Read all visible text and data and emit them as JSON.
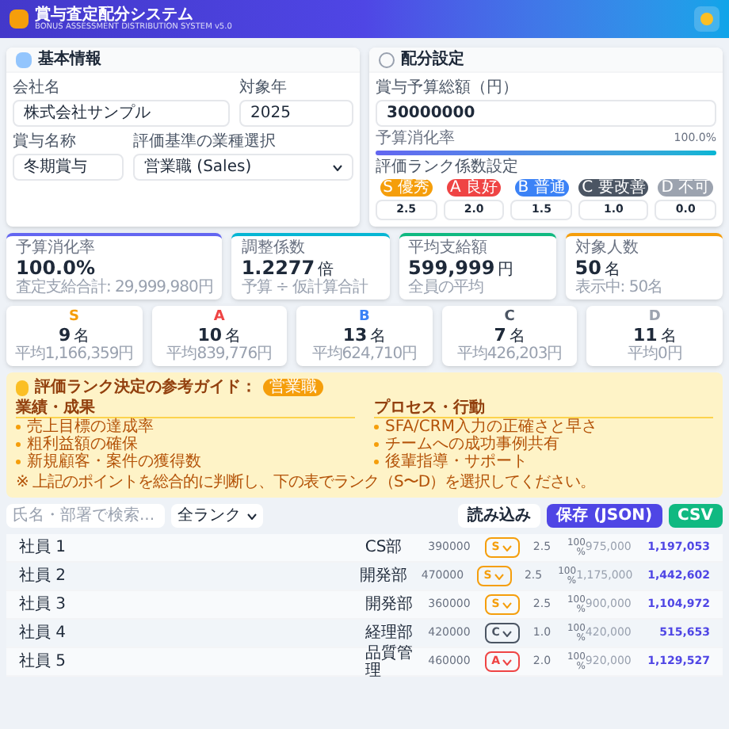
{
  "header": {
    "title": "賞与査定配分システム",
    "subtitle": "BONUS ASSESSMENT DISTRIBUTION SYSTEM v5.0"
  },
  "basic": {
    "title": "基本情報",
    "fields": [
      {
        "label": "会社名",
        "value": "株式会社サンプル"
      },
      {
        "label": "対象年",
        "value": "2025"
      },
      {
        "label": "賞与名称",
        "value": "冬期賞与"
      }
    ],
    "select": {
      "label": "評価基準の業種選択",
      "value": "営業職 (Sales)"
    }
  },
  "distribution": {
    "title": "配分設定",
    "budget_label": "賞与予算総額（円）",
    "budget": "30000000",
    "progress_label": "予算消化率",
    "progress_value": "100.0%",
    "level": 1.0,
    "coef_label": "評価ランク係数設定",
    "ranks": [
      {
        "label": "S 優秀",
        "value": "2.5",
        "color": "#f59e0b"
      },
      {
        "label": "A 良好",
        "value": "2.0",
        "color": "#ef4444"
      },
      {
        "label": "B 普通",
        "value": "1.5",
        "color": "#3b82f6"
      },
      {
        "label": "C 要改善",
        "value": "1.0",
        "color": "#4b5563"
      },
      {
        "label": "D 不可",
        "value": "0.0",
        "color": "#9ca3af"
      }
    ]
  },
  "stats": [
    {
      "label": "予算消化率",
      "value": "100.0%",
      "note": "査定支給合計: 29,999,980円",
      "color": "#6366f1"
    },
    {
      "label": "調整係数",
      "value": "1.2277",
      "unit": "倍",
      "note": "予算 ÷ 仮計算合計",
      "color": "#06b6d4"
    },
    {
      "label": "平均支給額",
      "value": "599,999",
      "unit": "円",
      "note": "全員の平均",
      "color": "#10b981"
    },
    {
      "label": "対象人数",
      "value": "50",
      "unit": "名",
      "note": "表示中: 50名",
      "color": "#f59e0b"
    }
  ],
  "rank_summary": [
    {
      "rank": "S",
      "count": "9",
      "unit": "名",
      "note": "平均1,166,359円",
      "color": "#f59e0b"
    },
    {
      "rank": "A",
      "count": "10",
      "unit": "名",
      "note": "平均839,776円",
      "color": "#ef4444"
    },
    {
      "rank": "B",
      "count": "13",
      "unit": "名",
      "note": "平均624,710円",
      "color": "#3b82f6"
    },
    {
      "rank": "C",
      "count": "7",
      "unit": "名",
      "note": "平均426,203円",
      "color": "#4b5563"
    },
    {
      "rank": "D",
      "count": "11",
      "unit": "名",
      "note": "平均0円",
      "color": "#9ca3af"
    }
  ],
  "guide": {
    "title": "評価ランク決定の参考ガイド：",
    "badge": "営業職",
    "columns": [
      {
        "heading": "業績・成果",
        "items": [
          "売上目標の達成率",
          "粗利益額の確保",
          "新規顧客・案件の獲得数"
        ]
      },
      {
        "heading": "プロセス・行動",
        "items": [
          "SFA/CRM入力の正確さと早さ",
          "チームへの成功事例共有",
          "後輩指導・サポート"
        ]
      }
    ],
    "note": "※ 上記のポイントを総合的に判断し、下の表でランク（S〜D）を選択してください。"
  },
  "toolbar": {
    "search_placeholder": "氏名・部署で検索...",
    "filter": "全ランク",
    "buttons": [
      {
        "label": "読み込み",
        "kind": "plain"
      },
      {
        "label": "保存 (JSON)",
        "kind": "primary"
      },
      {
        "label": "CSV",
        "kind": "success"
      }
    ]
  },
  "rows": [
    {
      "name": "社員 1",
      "dept": "CS部",
      "salary": "390000",
      "rank": "S",
      "color": "#f59e0b",
      "coef": "2.5",
      "rate": "100",
      "pct": "%",
      "base": "975,000",
      "final": "1,197,053"
    },
    {
      "name": "社員 2",
      "dept": "開発部",
      "salary": "470000",
      "rank": "S",
      "color": "#f59e0b",
      "coef": "2.5",
      "rate": "100",
      "pct": "%",
      "base": "1,175,000",
      "final": "1,442,602"
    },
    {
      "name": "社員 3",
      "dept": "開発部",
      "salary": "360000",
      "rank": "S",
      "color": "#f59e0b",
      "coef": "2.5",
      "rate": "100",
      "pct": "%",
      "base": "900,000",
      "final": "1,104,972"
    },
    {
      "name": "社員 4",
      "dept": "経理部",
      "salary": "420000",
      "rank": "C",
      "color": "#4b5563",
      "coef": "1.0",
      "rate": "100",
      "pct": "%",
      "base": "420,000",
      "final": "515,653"
    },
    {
      "name": "社員 5",
      "dept": "品質管理",
      "salary": "460000",
      "rank": "A",
      "color": "#ef4444",
      "coef": "2.0",
      "rate": "100",
      "pct": "%",
      "base": "920,000",
      "final": "1,129,527"
    }
  ]
}
